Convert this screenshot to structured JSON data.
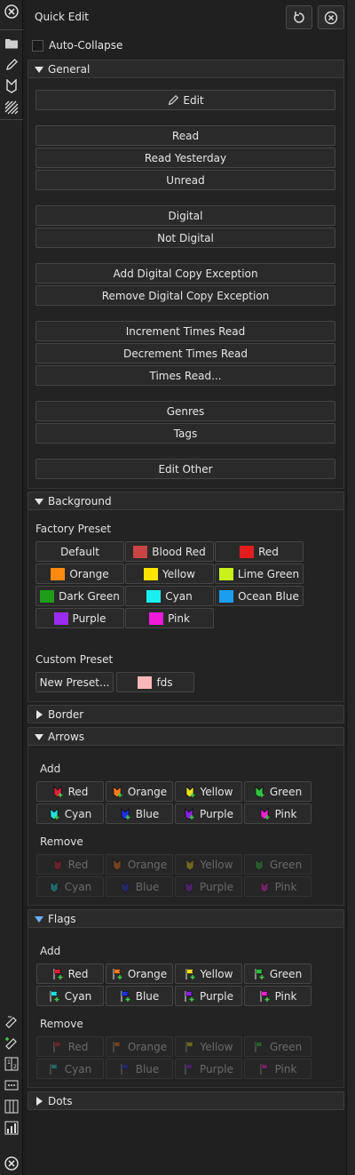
{
  "header": {
    "title": "Quick Edit"
  },
  "auto_collapse": {
    "label": "Auto-Collapse"
  },
  "sections": {
    "general": "General",
    "background": "Background",
    "border": "Border",
    "arrows": "Arrows",
    "flags": "Flags",
    "dots": "Dots"
  },
  "general": {
    "edit": "Edit",
    "read": "Read",
    "read_yesterday": "Read Yesterday",
    "unread": "Unread",
    "digital": "Digital",
    "not_digital": "Not Digital",
    "add_exc": "Add Digital Copy Exception",
    "remove_exc": "Remove Digital Copy Exception",
    "inc_times": "Increment Times Read",
    "dec_times": "Decrement Times Read",
    "times_read": "Times Read...",
    "genres": "Genres",
    "tags": "Tags",
    "edit_other": "Edit Other"
  },
  "background": {
    "factory_label": "Factory Preset",
    "custom_label": "Custom Preset",
    "presets": [
      {
        "label": "Default",
        "color": ""
      },
      {
        "label": "Blood Red",
        "color": "#c94444"
      },
      {
        "label": "Red",
        "color": "#e11d1d"
      },
      {
        "label": "Orange",
        "color": "#ff8a0f"
      },
      {
        "label": "Yellow",
        "color": "#fde500"
      },
      {
        "label": "Lime Green",
        "color": "#c9f21b"
      },
      {
        "label": "Dark Green",
        "color": "#1f9c1a"
      },
      {
        "label": "Cyan",
        "color": "#1bf0f0"
      },
      {
        "label": "Ocean Blue",
        "color": "#1a9ef0"
      },
      {
        "label": "Purple",
        "color": "#9b2bf0"
      },
      {
        "label": "Pink",
        "color": "#f01ad8"
      }
    ],
    "new_preset": "New Preset...",
    "custom_fds": {
      "label": "fds",
      "color": "#f8b8b8"
    }
  },
  "arrows": {
    "add_label": "Add",
    "remove_label": "Remove",
    "colors": [
      {
        "label": "Red",
        "color": "#e0203a"
      },
      {
        "label": "Orange",
        "color": "#ff7a1a"
      },
      {
        "label": "Yellow",
        "color": "#f0e020"
      },
      {
        "label": "Green",
        "color": "#30c040"
      },
      {
        "label": "Cyan",
        "color": "#20e0e0"
      },
      {
        "label": "Blue",
        "color": "#2030e0"
      },
      {
        "label": "Purple",
        "color": "#8a20e0"
      },
      {
        "label": "Pink",
        "color": "#f020d0"
      }
    ]
  },
  "flags": {
    "add_label": "Add",
    "remove_label": "Remove",
    "colors": [
      {
        "label": "Red",
        "color": "#e0203a"
      },
      {
        "label": "Orange",
        "color": "#ff7a1a"
      },
      {
        "label": "Yellow",
        "color": "#f0e020"
      },
      {
        "label": "Green",
        "color": "#30c040"
      },
      {
        "label": "Cyan",
        "color": "#20e0e0"
      },
      {
        "label": "Blue",
        "color": "#2030e0"
      },
      {
        "label": "Purple",
        "color": "#8a20e0"
      },
      {
        "label": "Pink",
        "color": "#f020d0"
      }
    ]
  },
  "rail_icons": [
    "close-icon",
    "folder-icon",
    "pencil-icon",
    "bookmark-icon",
    "stripes-icon",
    "pen-edit-icon",
    "pen-add-icon",
    "columns-icon",
    "dots-icon",
    "table-icon",
    "chart-icon",
    "close-icon"
  ]
}
